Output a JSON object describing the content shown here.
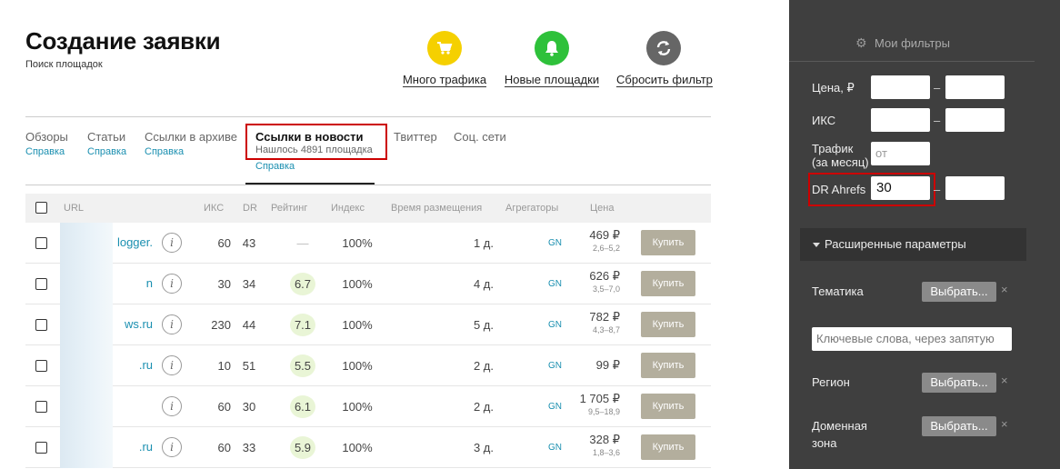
{
  "header": {
    "title": "Создание заявки",
    "subtitle": "Поиск площадок"
  },
  "quick_actions": [
    {
      "label": "Много трафика",
      "icon": "cart-icon",
      "color": "#f5d000"
    },
    {
      "label": "Новые площадки",
      "icon": "bell-icon",
      "color": "#2ec13a"
    },
    {
      "label": "Сбросить фильтр",
      "icon": "refresh-icon",
      "color": "#666666"
    }
  ],
  "tabs": [
    {
      "name": "Обзоры",
      "help": "Справка"
    },
    {
      "name": "Статьи",
      "help": "Справка"
    },
    {
      "name": "Ссылки в архиве",
      "help": "Справка"
    },
    {
      "name": "Ссылки в новости",
      "count": "Нашлось 4891 площадка",
      "help": "Справка",
      "active": true
    },
    {
      "name": "Твиттер"
    },
    {
      "name": "Соц. сети"
    }
  ],
  "table": {
    "columns": [
      "URL",
      "ИКС",
      "DR",
      "Рейтинг",
      "Индекс",
      "Время размещения",
      "Агрегаторы",
      "Цена"
    ],
    "rows": [
      {
        "url": "logger.",
        "iks": "60",
        "dr": "43",
        "rating": "—",
        "index": "100%",
        "time": "1 д.",
        "agg": "GN",
        "price": "469 ₽",
        "range": "2,6–5,2",
        "buy": "Купить"
      },
      {
        "url": "n",
        "iks": "30",
        "dr": "34",
        "rating": "6.7",
        "index": "100%",
        "time": "4 д.",
        "agg": "GN",
        "price": "626 ₽",
        "range": "3,5–7,0",
        "buy": "Купить"
      },
      {
        "url": "ws.ru",
        "iks": "230",
        "dr": "44",
        "rating": "7.1",
        "index": "100%",
        "time": "5 д.",
        "agg": "GN",
        "price": "782 ₽",
        "range": "4,3–8,7",
        "buy": "Купить"
      },
      {
        "url": ".ru",
        "iks": "10",
        "dr": "51",
        "rating": "5.5",
        "index": "100%",
        "time": "2 д.",
        "agg": "GN",
        "price": "99 ₽",
        "range": "",
        "buy": "Купить"
      },
      {
        "url": "",
        "iks": "60",
        "dr": "30",
        "rating": "6.1",
        "index": "100%",
        "time": "2 д.",
        "agg": "GN",
        "price": "1 705 ₽",
        "range": "9,5–18,9",
        "buy": "Купить"
      },
      {
        "url": ".ru",
        "iks": "60",
        "dr": "33",
        "rating": "5.9",
        "index": "100%",
        "time": "3 д.",
        "agg": "GN",
        "price": "328 ₽",
        "range": "1,8–3,6",
        "buy": "Купить"
      }
    ]
  },
  "sidebar": {
    "header": "Мои фильтры",
    "filters": {
      "price_label": "Цена, ₽",
      "iks_label": "ИКС",
      "traffic_label_1": "Трафик",
      "traffic_label_2": "(за месяц)",
      "traffic_from_placeholder": "от",
      "dr_label": "DR Ahrefs",
      "dr_from_value": "30",
      "dash": "–"
    },
    "advanced": "Расширенные параметры",
    "theme_label": "Тематика",
    "choose_label": "Выбрать...",
    "keywords_placeholder": "Ключевые слова, через запятую",
    "region_label": "Регион",
    "domain_label_1": "Доменная",
    "domain_label_2": "зона",
    "clear": "×"
  }
}
